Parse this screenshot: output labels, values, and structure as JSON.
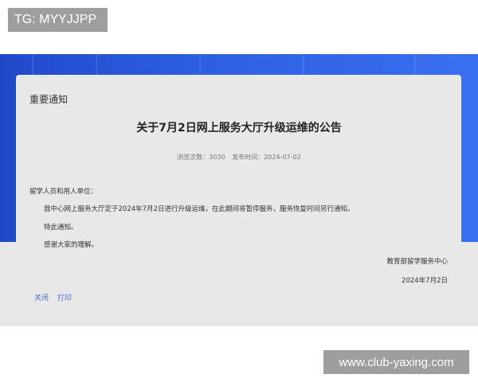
{
  "overlay_tag": "TG: MYYJJPP",
  "notice": {
    "section_label": "重要通知",
    "title": "关于7月2日网上服务大厅升级运维的公告",
    "meta": {
      "views_label": "浏览次数：",
      "views_value": "3030",
      "published_label": "发布时间：",
      "published_value": "2024-07-02"
    },
    "greeting": "留学人员和用人单位：",
    "paragraphs": [
      "我中心网上服务大厅定于2024年7月2日进行升级运维，在此期间将暂停服务，服务恢复时间另行通知。",
      "特此通知。",
      "感谢大家的理解。"
    ],
    "signature": "教育部留学服务中心",
    "sign_date": "2024年7月2日"
  },
  "actions": {
    "close_label": "关闭",
    "print_label": "打印"
  },
  "watermark_url": "www.club-yaxing.com",
  "colors": {
    "banner_blue": "#2d5ee0",
    "card_bg": "#e8e8e8",
    "link": "#4a6cc9",
    "tag_bg": "#9e9e9e"
  }
}
